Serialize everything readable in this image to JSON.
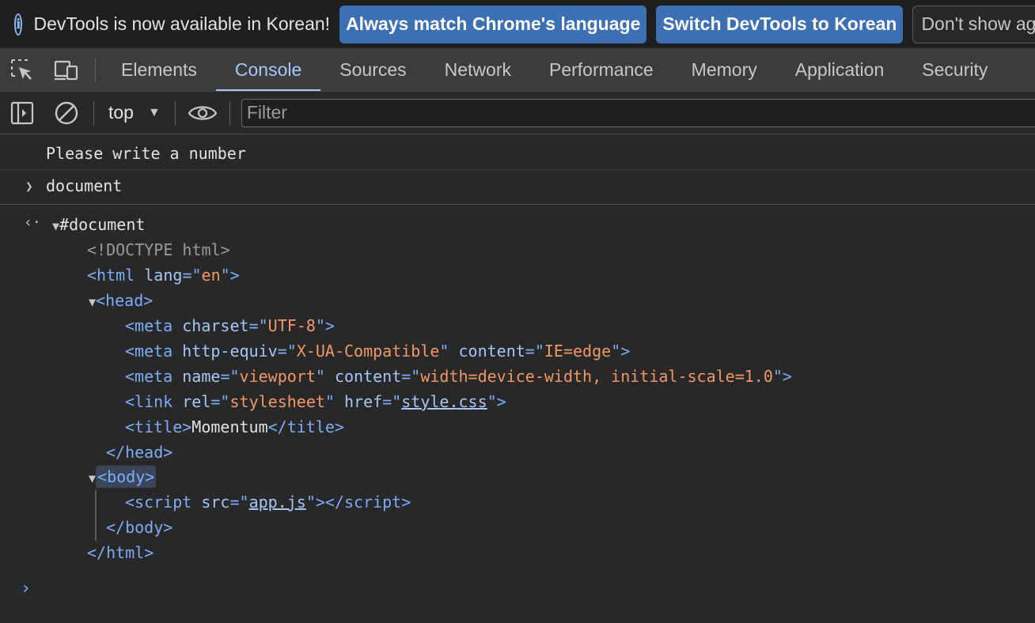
{
  "infobar": {
    "message": "DevTools is now available in Korean!",
    "btn_match": "Always match Chrome's language",
    "btn_switch": "Switch DevTools to Korean",
    "btn_dont_show": "Don't show again"
  },
  "tabs": [
    "Elements",
    "Console",
    "Sources",
    "Network",
    "Performance",
    "Memory",
    "Application",
    "Security"
  ],
  "active_tab": "Console",
  "toolbar": {
    "context": "top",
    "filter_placeholder": "Filter"
  },
  "console": {
    "log_message": "Please write a number",
    "input": "document",
    "result_root": "#document",
    "tree": {
      "doctype": "<!DOCTYPE html>",
      "html_open": "<html",
      "html_lang_attr": "lang",
      "html_lang_val": "en",
      "head_open": "<head>",
      "meta1_attr": "charset",
      "meta1_val": "UTF-8",
      "meta2_attr1": "http-equiv",
      "meta2_val1": "X-UA-Compatible",
      "meta2_attr2": "content",
      "meta2_val2": "IE=edge",
      "meta3_attr1": "name",
      "meta3_val1": "viewport",
      "meta3_attr2": "content",
      "meta3_val2": "width=device-width, initial-scale=1.0",
      "link_rel_attr": "rel",
      "link_rel_val": "stylesheet",
      "link_href_attr": "href",
      "link_href_val": "style.css",
      "title_text": "Momentum",
      "head_close": "</head>",
      "body_open": "<body>",
      "script_src_attr": "src",
      "script_src_val": "app.js",
      "body_close": "</body>",
      "html_close": "</html>"
    }
  },
  "colors": {
    "accent": "#a8c7fa",
    "tag": "#7cacf8",
    "attr_value": "#f29766",
    "primary_button": "#3d6fb3"
  }
}
